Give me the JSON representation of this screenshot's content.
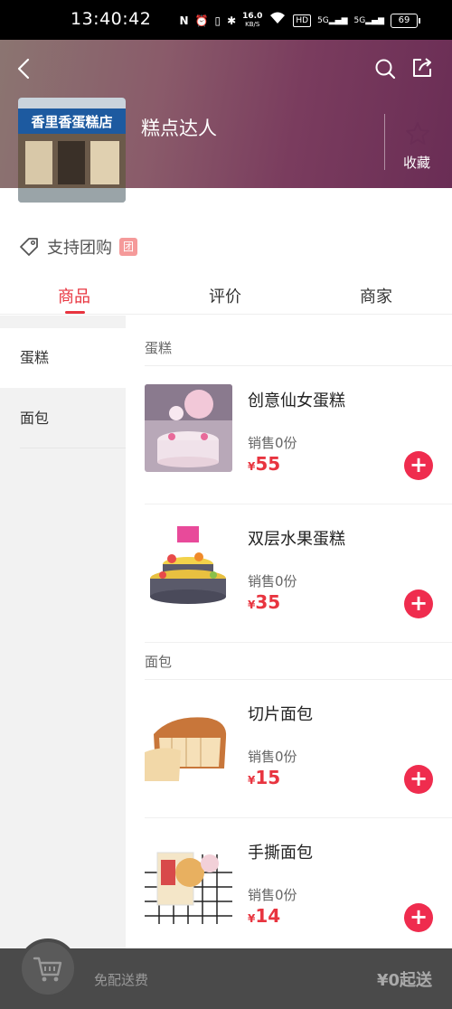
{
  "status": {
    "time": "13:40:42",
    "net_speed_value": "16.0",
    "net_speed_unit": "KB/S",
    "signal1": "5G",
    "signal2": "5G",
    "hd": "HD",
    "battery": "69"
  },
  "shop": {
    "name": "糕点达人",
    "image_sign": "香里香蛋糕店",
    "favorite_label": "收藏"
  },
  "groupbuy": {
    "label": "支持团购",
    "badge": "团"
  },
  "tabs": [
    {
      "label": "商品"
    },
    {
      "label": "评价"
    },
    {
      "label": "商家"
    }
  ],
  "categories": [
    {
      "label": "蛋糕"
    },
    {
      "label": "面包"
    }
  ],
  "sections": [
    {
      "title": "蛋糕",
      "products": [
        {
          "name": "创意仙女蛋糕",
          "sales": "销售0份",
          "currency": "¥",
          "price": "55"
        },
        {
          "name": "双层水果蛋糕",
          "sales": "销售0份",
          "currency": "¥",
          "price": "35"
        }
      ]
    },
    {
      "title": "面包",
      "products": [
        {
          "name": "切片面包",
          "sales": "销售0份",
          "currency": "¥",
          "price": "15"
        },
        {
          "name": "手撕面包",
          "sales": "销售0份",
          "currency": "¥",
          "price": "14"
        }
      ]
    }
  ],
  "bottom": {
    "delivery_text": "免配送费",
    "min_order": "¥0起送"
  },
  "colors": {
    "accent": "#e8343f",
    "add_button": "#ef2c4e",
    "bottom_bar": "#4a4a4a"
  }
}
